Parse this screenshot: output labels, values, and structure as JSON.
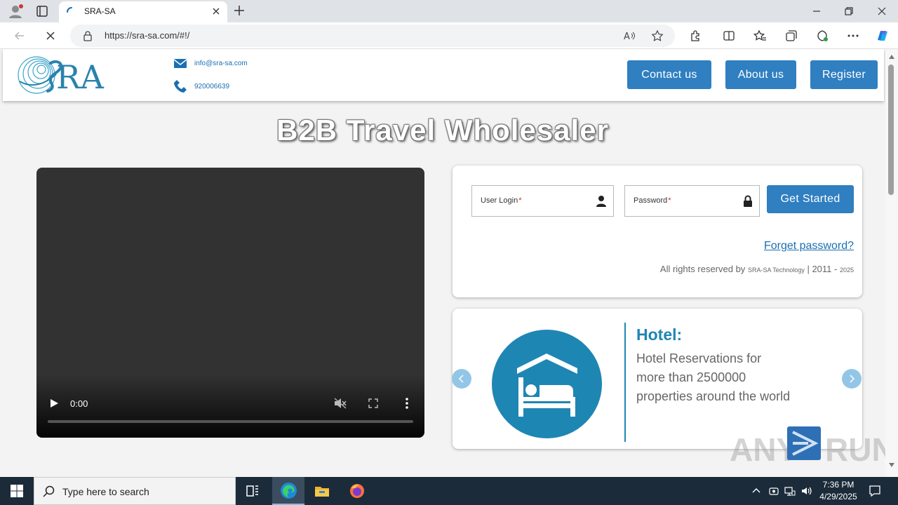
{
  "browser": {
    "tab_title": "SRA-SA",
    "url": "https://sra-sa.com/#!/"
  },
  "header": {
    "email": "info@sra-sa.com",
    "phone": "920006639",
    "buttons": {
      "contact": "Contact us",
      "about": "About us",
      "register": "Register"
    }
  },
  "hero": {
    "title": "B2B Travel Wholesaler"
  },
  "video": {
    "time": "0:00"
  },
  "login": {
    "user_label": "User Login",
    "password_label": "Password",
    "required_mark": "*",
    "submit": "Get Started",
    "forget": "Forget password?",
    "rights_prefix": "All rights reserved by",
    "rights_company": "SRA-SA Technology",
    "rights_years": "| 2011 -",
    "rights_year_end": "2025"
  },
  "slider": {
    "title": "Hotel:",
    "description": "Hotel Reservations for more than 2500000 properties around the world"
  },
  "watermark": {
    "text_left": "ANY",
    "text_right": "RUN"
  },
  "taskbar": {
    "search_placeholder": "Type here to search",
    "time": "7:36 PM",
    "date": "4/29/2025"
  },
  "colors": {
    "brand_blue": "#2f7fc1",
    "hotel_teal": "#1e86b3"
  }
}
